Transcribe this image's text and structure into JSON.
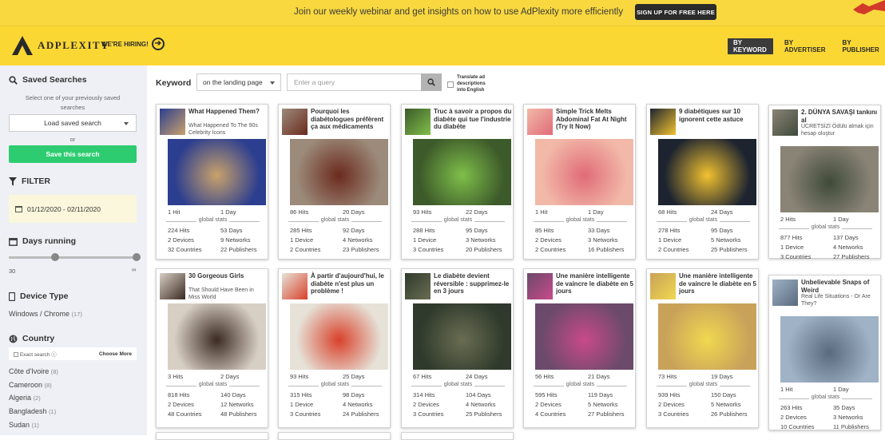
{
  "banner": {
    "text": "Join our weekly webinar and get insights on how to use AdPlexity more efficiently",
    "button": "SIGN UP FOR FREE HERE"
  },
  "header": {
    "logo": "ADPLEXITY",
    "hiring": "WE'RE HIRING!",
    "nav": [
      "BY KEYWORD",
      "BY ADVERTISER",
      "BY PUBLISHER"
    ]
  },
  "sidebar": {
    "saved_searches": {
      "title": "Saved Searches",
      "hint": "Select one of your previously saved searches",
      "load": "Load saved search",
      "or": "or",
      "save": "Save this search"
    },
    "filter": {
      "title": "FILTER",
      "date_range": "01/12/2020 - 02/11/2020"
    },
    "days_running": {
      "title": "Days running",
      "min": "30",
      "max": "∞"
    },
    "device_type": {
      "title": "Device Type",
      "value": "Windows / Chrome",
      "count": "(17)"
    },
    "country": {
      "title": "Country",
      "exact": "Exact search",
      "choose": "Choose More",
      "items": [
        {
          "name": "Côte d'Ivoire",
          "count": "(8)"
        },
        {
          "name": "Cameroon",
          "count": "(8)"
        },
        {
          "name": "Algeria",
          "count": "(2)"
        },
        {
          "name": "Bangladesh",
          "count": "(1)"
        },
        {
          "name": "Sudan",
          "count": "(1)"
        }
      ]
    }
  },
  "search": {
    "label": "Keyword",
    "mode": "on the landing page",
    "placeholder": "Enter a query",
    "translate": "Translate ad descriptions into English"
  },
  "global_label": "global stats",
  "ads": [
    {
      "title": "What Happened Them?",
      "sub": "What Happened To The 90s Celebrity Icons",
      "hits": "1 Hit",
      "days": "1 Day",
      "g_hits": "224 Hits",
      "g_days": "53 Days",
      "devices": "2 Devices",
      "networks": "9 Networks",
      "countries": "32 Countries",
      "publishers": "22 Publishers",
      "c1": "#2c3e8f",
      "c2": "#c9a26b"
    },
    {
      "title": "Pourquoi les diabétologues préfèrent ça aux médicaments",
      "sub": "",
      "hits": "86 Hits",
      "days": "20 Days",
      "g_hits": "285 Hits",
      "g_days": "92 Days",
      "devices": "1 Device",
      "networks": "4 Networks",
      "countries": "2 Countries",
      "publishers": "23 Publishers",
      "c1": "#9c8b7a",
      "c2": "#6b2a1e"
    },
    {
      "title": "Truc à savoir a propos du diabète qui tue l'industrie du diabète",
      "sub": "",
      "hits": "93 Hits",
      "days": "22 Days",
      "g_hits": "288 Hits",
      "g_days": "95 Days",
      "devices": "1 Device",
      "networks": "3 Networks",
      "countries": "3 Countries",
      "publishers": "20 Publishers",
      "c1": "#3d5a2a",
      "c2": "#7fbf4a"
    },
    {
      "title": "Simple Trick Melts Abdominal Fat At Night (Try It Now)",
      "sub": "",
      "hits": "1 Hit",
      "days": "1 Day",
      "g_hits": "85 Hits",
      "g_days": "33 Days",
      "devices": "2 Devices",
      "networks": "3 Networks",
      "countries": "2 Countries",
      "publishers": "16 Publishers",
      "c1": "#f2b9a8",
      "c2": "#e06b78"
    },
    {
      "title": "9 diabétiques sur 10 ignorent cette astuce",
      "sub": "",
      "hits": "68 Hits",
      "days": "24 Days",
      "g_hits": "278 Hits",
      "g_days": "95 Days",
      "devices": "1 Device",
      "networks": "5 Networks",
      "countries": "2 Countries",
      "publishers": "25 Publishers",
      "c1": "#1d2430",
      "c2": "#f2c230"
    },
    {
      "title": "2. DÜNYA SAVAŞI tankını al",
      "sub": "ÜCRETSİZİ Ödülü almak için hesap oluştur",
      "hits": "2 Hits",
      "days": "1 Day",
      "g_hits": "877 Hits",
      "g_days": "137 Days",
      "devices": "1 Device",
      "networks": "4 Networks",
      "countries": "3 Countries",
      "publishers": "27 Publishers",
      "c1": "#8a8476",
      "c2": "#3f4a3a"
    },
    {
      "title": "30 Gorgeous Girls",
      "sub": "That Should Have Been in Miss World",
      "hits": "3 Hits",
      "days": "2 Days",
      "g_hits": "818 Hits",
      "g_days": "140 Days",
      "devices": "2 Devices",
      "networks": "12 Networks",
      "countries": "48 Countries",
      "publishers": "48 Publishers",
      "c1": "#d8cfc4",
      "c2": "#3b2a22"
    },
    {
      "title": "À partir d'aujourd'hui, le diabète n'est plus un problème !",
      "sub": "",
      "hits": "93 Hits",
      "days": "25 Days",
      "g_hits": "315 Hits",
      "g_days": "98 Days",
      "devices": "1 Device",
      "networks": "4 Networks",
      "countries": "3 Countries",
      "publishers": "24 Publishers",
      "c1": "#e6e2d8",
      "c2": "#d9412a"
    },
    {
      "title": "Le diabète devient réversible : supprimez-le en 3 jours",
      "sub": "",
      "hits": "67 Hits",
      "days": "24 Days",
      "g_hits": "314 Hits",
      "g_days": "104 Days",
      "devices": "2 Devices",
      "networks": "4 Networks",
      "countries": "3 Countries",
      "publishers": "25 Publishers",
      "c1": "#2f3a2c",
      "c2": "#6a6d52"
    },
    {
      "title": "Une manière intelligente de vaincre le diabète en 5 jours",
      "sub": "",
      "hits": "56 Hits",
      "days": "21 Days",
      "g_hits": "595 Hits",
      "g_days": "119 Days",
      "devices": "2 Devices",
      "networks": "5 Networks",
      "countries": "4 Countries",
      "publishers": "27 Publishers",
      "c1": "#6b4a6a",
      "c2": "#c94a8a"
    },
    {
      "title": "Une manière intelligente de vaincre le diabète en 5 jours",
      "sub": "",
      "hits": "73 Hits",
      "days": "19 Days",
      "g_hits": "939 Hits",
      "g_days": "150 Days",
      "devices": "2 Devices",
      "networks": "5 Networks",
      "countries": "3 Countries",
      "publishers": "26 Publishers",
      "c1": "#c9a25a",
      "c2": "#f0d850"
    },
    {
      "title": "Unbelievable Snaps of Weird",
      "sub": "Real Life Situations - Or Are They?",
      "hits": "1 Hit",
      "days": "1 Day",
      "g_hits": "263 Hits",
      "g_days": "35 Days",
      "devices": "2 Devices",
      "networks": "3 Networks",
      "countries": "10 Countries",
      "publishers": "11 Publishers",
      "c1": "#9fb2c6",
      "c2": "#5a6a7e"
    }
  ]
}
